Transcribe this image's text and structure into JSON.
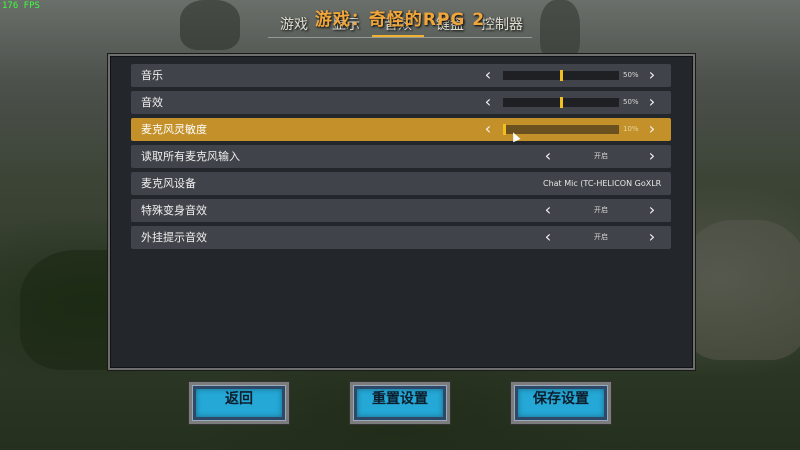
{
  "fps": "176 FPS",
  "title": "游戏：奇怪的RPG 2",
  "tabs": [
    {
      "label": "游戏"
    },
    {
      "label": "显示"
    },
    {
      "label": "音效"
    },
    {
      "label": "键盘"
    },
    {
      "label": "控制器"
    }
  ],
  "active_tab": "音效",
  "settings": {
    "music": {
      "label": "音乐",
      "value": "50%",
      "level": 0.5
    },
    "sfx": {
      "label": "音效",
      "value": "50%",
      "level": 0.5
    },
    "mic_sensitivity": {
      "label": "麦克风灵敏度",
      "value": "10%",
      "level": 0.0
    },
    "read_all_mic": {
      "label": "读取所有麦克风输入",
      "value": "开启"
    },
    "mic_device": {
      "label": "麦克风设备",
      "value": "Chat Mic (TC-HELICON GoXLR)"
    },
    "special_voice": {
      "label": "特殊变身音效",
      "value": "开启"
    },
    "plugin_sound": {
      "label": "外挂提示音效",
      "value": "开启"
    }
  },
  "arrows": {
    "left": "‹",
    "right": "›"
  },
  "buttons": {
    "back": "返回",
    "reset": "重置设置",
    "save": "保存设置"
  },
  "colors": {
    "accent": "#c3902a",
    "title": "#f0a63a",
    "button": "#25a8d6",
    "slider_marker": "#f0c020",
    "fps": "#3cff3c"
  }
}
